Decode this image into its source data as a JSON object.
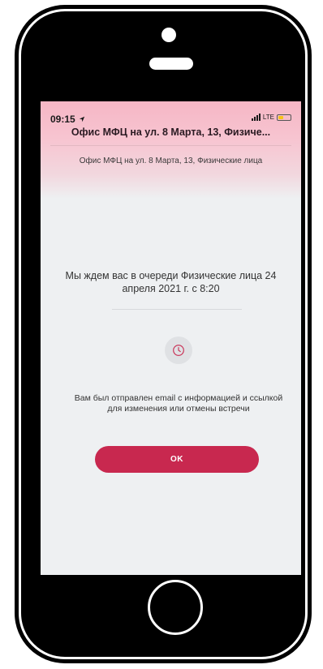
{
  "status_bar": {
    "time": "09:15",
    "network": "LTE",
    "colors": {
      "battery": "#f5c518"
    },
    "icons": [
      "location-arrow-icon",
      "signal-icon",
      "battery-icon"
    ]
  },
  "header": {
    "title": "Офис МФЦ на ул. 8 Марта, 13, Физиче...",
    "subtitle": "Офис МФЦ на ул. 8 Марта, 13, Физические лица"
  },
  "main": {
    "message": "Мы ждем вас в очереди Физические лица 24 апреля 2021 г. с 8:20",
    "icon": "clock-icon",
    "email_note": "Вам был отправлен email с информацией и ссылкой для изменения или отмены встречи",
    "ok_label": "OK"
  },
  "colors": {
    "accent": "#c8284f",
    "header_gradient_top": "#f6b6c5",
    "background": "#eef0f2"
  }
}
